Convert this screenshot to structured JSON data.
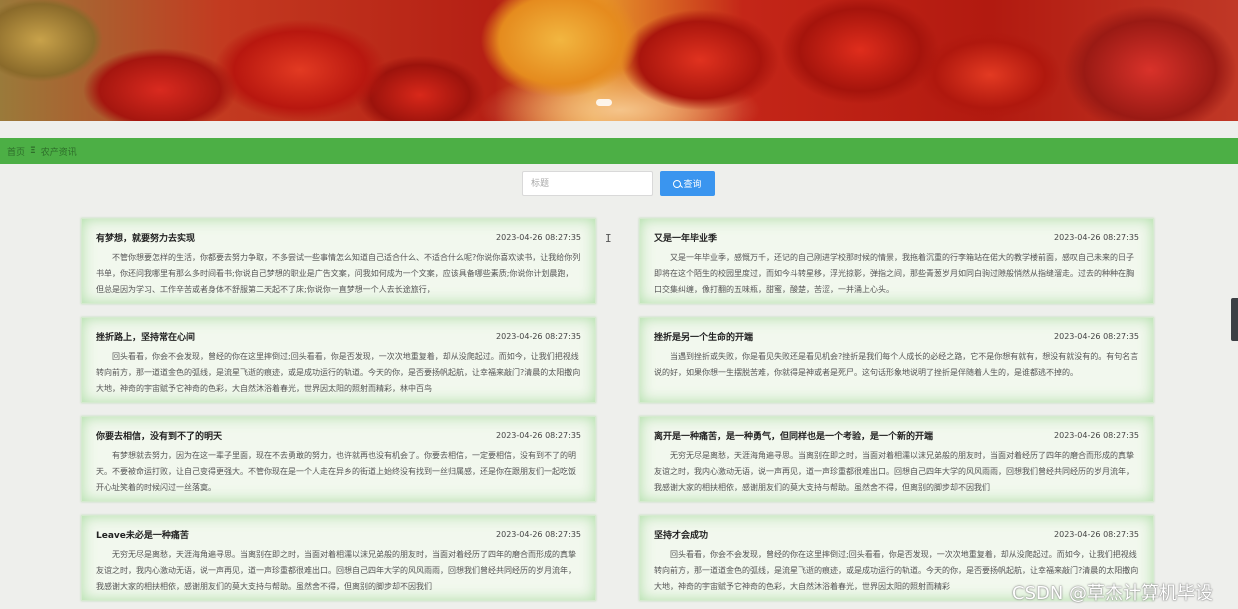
{
  "breadcrumb": {
    "home": "首页",
    "separator": "Ξ",
    "current": "农产资讯"
  },
  "search": {
    "placeholder": "标题",
    "button_label": "查询"
  },
  "articles": [
    {
      "title": "有梦想，就要努力去实现",
      "date": "2023-04-26 08:27:35",
      "summary": "不管你想要怎样的生活，你都要去努力争取，不多尝试一些事情怎么知道自己适合什么、不适合什么呢?你说你喜欢读书，让我给你列书单，你还问我哪里有那么多时间看书;你说自己梦想的职业是广告文案，问我如何成为一个文案，应该具备哪些素质;你说你计划晨跑，但总是因为学习、工作辛苦或者身体不舒服第二天起不了床;你说你一直梦想一个人去长途旅行，"
    },
    {
      "title": "又是一年毕业季",
      "date": "2023-04-26 08:27:35",
      "summary": "又是一年毕业季，感慨万千，还记的自己刚进学校那时候的情景，我拖着沉重的行李箱站在偌大的教学楼前面，感叹自己未来的日子即将在这个陌生的校园里度过，而如今斗转星移，浮光掠影，弹指之间，那些青葱岁月如同白驹过隙般悄然从指缝溜走。过去的种种在胸口交集纠缠，像打翻的五味瓶，甜蜜，酸楚，苦涩，一并涌上心头。"
    },
    {
      "title": "挫折路上，坚持常在心间",
      "date": "2023-04-26 08:27:35",
      "summary": "回头看看，你会不会发现，曾经的你在这里摔倒过;回头看看，你是否发现，一次次地重复着，却从没爬起过。而如今，让我们把视线转向前方，那一道道金色的弧线，是流星飞逝的痕迹，或是成功运行的轨道。今天的你，是否要扬帆起航，让幸福来敲门?清晨的太阳撒向大地，神奇的宇宙赋予它神奇的色彩，大自然沐浴着春光，世界因太阳的照射而精彩，林中百鸟"
    },
    {
      "title": "挫折是另一个生命的开端",
      "date": "2023-04-26 08:27:35",
      "summary": "当遇到挫折或失败，你是看见失败还是看见机会?挫折是我们每个人成长的必经之路，它不是你想有就有，想没有就没有的。有句名言说的好，如果你想一生摆脱苦难，你就得是神或者是死尸。这句话形象地说明了挫折是伴随着人生的，是谁都逃不掉的。"
    },
    {
      "title": "你要去相信，没有到不了的明天",
      "date": "2023-04-26 08:27:35",
      "summary": "有梦想就去努力，因为在这一辈子里面，现在不去勇敢的努力，也许就再也没有机会了。你要去相信，一定要相信，没有到不了的明天。不要被命运打败，让自己变得更强大。不管你现在是一个人走在异乡的街道上始终没有找到一丝归属感，还是你在跟朋友们一起吃饭开心址笑着的时候闪过一丝落寞。"
    },
    {
      "title": "离开是一种痛苦，是一种勇气，但同样也是一个考验，是一个新的开端",
      "date": "2023-04-26 08:27:35",
      "summary": "无穷无尽是离愁，天涯海角遍寻思。当离别在即之时，当面对着相濡以沫兄弟般的朋友时，当面对着经历了四年的磨合而形成的真挚友谊之时，我内心激动无语，说一声再见，道一声珍重都很难出口。回想自己四年大学的风风雨雨，回想我们曾经共同经历的岁月流年，我感谢大家的相扶相依，感谢朋友们的莫大支持与帮助。虽然舍不得，但离别的脚步却不因我们"
    },
    {
      "title": "Leave未必是一种痛苦",
      "date": "2023-04-26 08:27:35",
      "summary": "无穷无尽是离愁，天涯海角遍寻思。当离别在即之时，当面对着相濡以沫兄弟般的朋友时，当面对着经历了四年的磨合而形成的真挚友谊之时，我内心激动无语，说一声再见，道一声珍重都很难出口。回想自己四年大学的风风雨雨，回想我们曾经共同经历的岁月流年，我感谢大家的相扶相依，感谢朋友们的莫大支持与帮助。虽然舍不得，但离别的脚步却不因我们"
    },
    {
      "title": "坚持才会成功",
      "date": "2023-04-26 08:27:35",
      "summary": "回头看看，你会不会发现，曾经的你在这里摔倒过;回头看看，你是否发现，一次次地重复着，却从没爬起过。而如今，让我们把视线转向前方，那一道道金色的弧线，是流星飞逝的痕迹，或是成功运行的轨道。今天的你，是否要扬帆起航，让幸福来敲门?清晨的太阳撒向大地，神奇的宇宙赋予它神奇的色彩，大自然沐浴着春光，世界因太阳的照射而精彩"
    }
  ],
  "watermark": "CSDN @草杰计算机毕设",
  "icons": {
    "search": "search-icon",
    "cursor": "text-cursor-icon"
  },
  "colors": {
    "breadcrumb_bg": "#4caf45",
    "search_button": "#3a95ef",
    "card_glow": "#78c86e"
  }
}
